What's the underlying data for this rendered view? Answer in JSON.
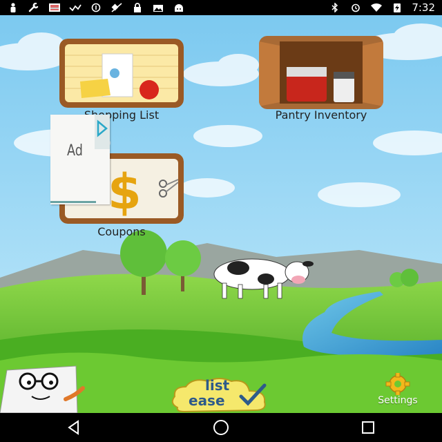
{
  "status_bar": {
    "time": "7:32",
    "left_icons": [
      "person-icon",
      "wrench-icon",
      "image-icon",
      "signal-check-icon",
      "alert-circle-icon",
      "satellite-off-icon",
      "lock-icon",
      "photo-icon",
      "android-icon"
    ],
    "right_icons": [
      "bluetooth-icon",
      "alarm-icon",
      "wifi-icon",
      "battery-charging-icon"
    ]
  },
  "tiles": {
    "shopping_list": {
      "label": "Shopping List"
    },
    "pantry_inventory": {
      "label": "Pantry Inventory"
    },
    "coupons": {
      "label": "Coupons"
    }
  },
  "ad": {
    "text": "Ad"
  },
  "bottom": {
    "logo_line1": "list",
    "logo_line2": "ease",
    "settings_label": "Settings"
  },
  "colors": {
    "sky": "#8fd3f5",
    "grass": "#5cbf2a",
    "wood": "#a0622d",
    "statusbar": "#000000"
  }
}
